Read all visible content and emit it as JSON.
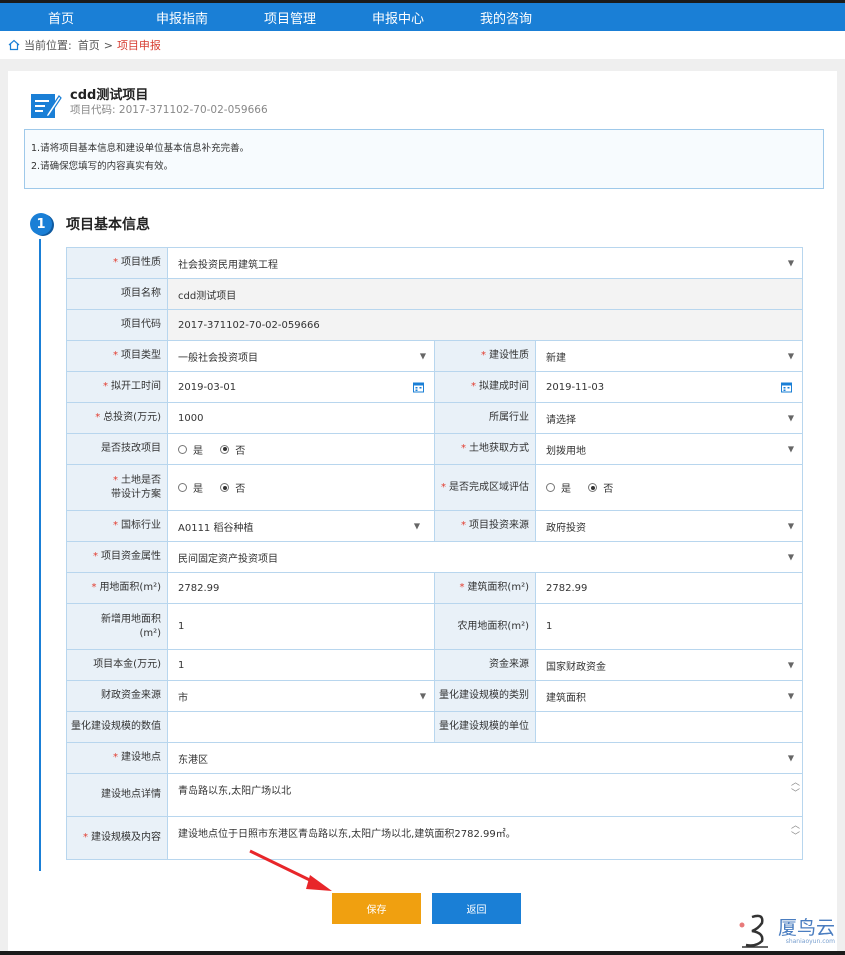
{
  "nav": [
    "首页",
    "申报指南",
    "项目管理",
    "申报中心",
    "我的咨询"
  ],
  "breadcrumb": {
    "prefix": "当前位置:",
    "home": "首页",
    "sep": ">",
    "current": "项目申报"
  },
  "project": {
    "title": "cdd测试项目",
    "code_label": "项目代码:",
    "code": "2017-371102-70-02-059666"
  },
  "notice": [
    "1.请将项目基本信息和建设单位基本信息补充完善。",
    "2.请确保您填写的内容真实有效。"
  ],
  "section": {
    "number": "1",
    "title": "项目基本信息"
  },
  "form": {
    "nature_label": "项目性质",
    "nature": "社会投资民用建筑工程",
    "name_label": "项目名称",
    "name": "cdd测试项目",
    "code_label": "项目代码",
    "code": "2017-371102-70-02-059666",
    "type_label": "项目类型",
    "type": "一般社会投资项目",
    "build_nature_label": "建设性质",
    "build_nature": "新建",
    "start_label": "拟开工时间",
    "start": "2019-03-01",
    "finish_label": "拟建成时间",
    "finish": "2019-11-03",
    "invest_label": "总投资(万元)",
    "invest": "1000",
    "industry_label": "所属行业",
    "industry": "请选择",
    "tech_label": "是否技改项目",
    "land_method_label": "土地获取方式",
    "land_method": "划拨用地",
    "land_design_label_1": "土地是否",
    "land_design_label_2": "带设计方案",
    "region_eval_label": "是否完成区域评估",
    "yes": "是",
    "no": "否",
    "nat_industry_label": "国标行业",
    "nat_industry": "A0111 稻谷种植",
    "source_label": "项目投资来源",
    "source": "政府投资",
    "fund_attr_label": "项目资金属性",
    "fund_attr": "民间固定资产投资项目",
    "land_area_label": "用地面积(m²)",
    "land_area": "2782.99",
    "build_area_label": "建筑面积(m²)",
    "build_area": "2782.99",
    "new_land_label_1": "新增用地面积",
    "new_land_label_2": "(m²)",
    "new_land": "1",
    "farm_land_label": "农用地面积(m²)",
    "farm_land": "1",
    "capital_label": "项目本金(万元)",
    "capital": "1",
    "fund_src_label": "资金来源",
    "fund_src": "国家财政资金",
    "fiscal_label": "财政资金来源",
    "fiscal": "市",
    "scale_type_label": "量化建设规模的类别",
    "scale_type": "建筑面积",
    "scale_value_label": "量化建设规模的数值",
    "scale_value": "",
    "scale_unit_label": "量化建设规模的单位",
    "scale_unit": "",
    "location_label": "建设地点",
    "location": "东港区",
    "location_detail_label": "建设地点详情",
    "location_detail": "青岛路以东,太阳广场以北",
    "scale_content_label": "建设规模及内容",
    "scale_content": "建设地点位于日照市东港区青岛路以东,太阳广场以北,建筑面积2782.99㎡。"
  },
  "buttons": {
    "save": "保存",
    "back": "返回"
  },
  "watermark": {
    "text": "厦鸟云",
    "sub": "shaniaoyun.com"
  },
  "colors": {
    "primary": "#1a7fd6",
    "save": "#f0a010",
    "required": "#e23b2d"
  }
}
